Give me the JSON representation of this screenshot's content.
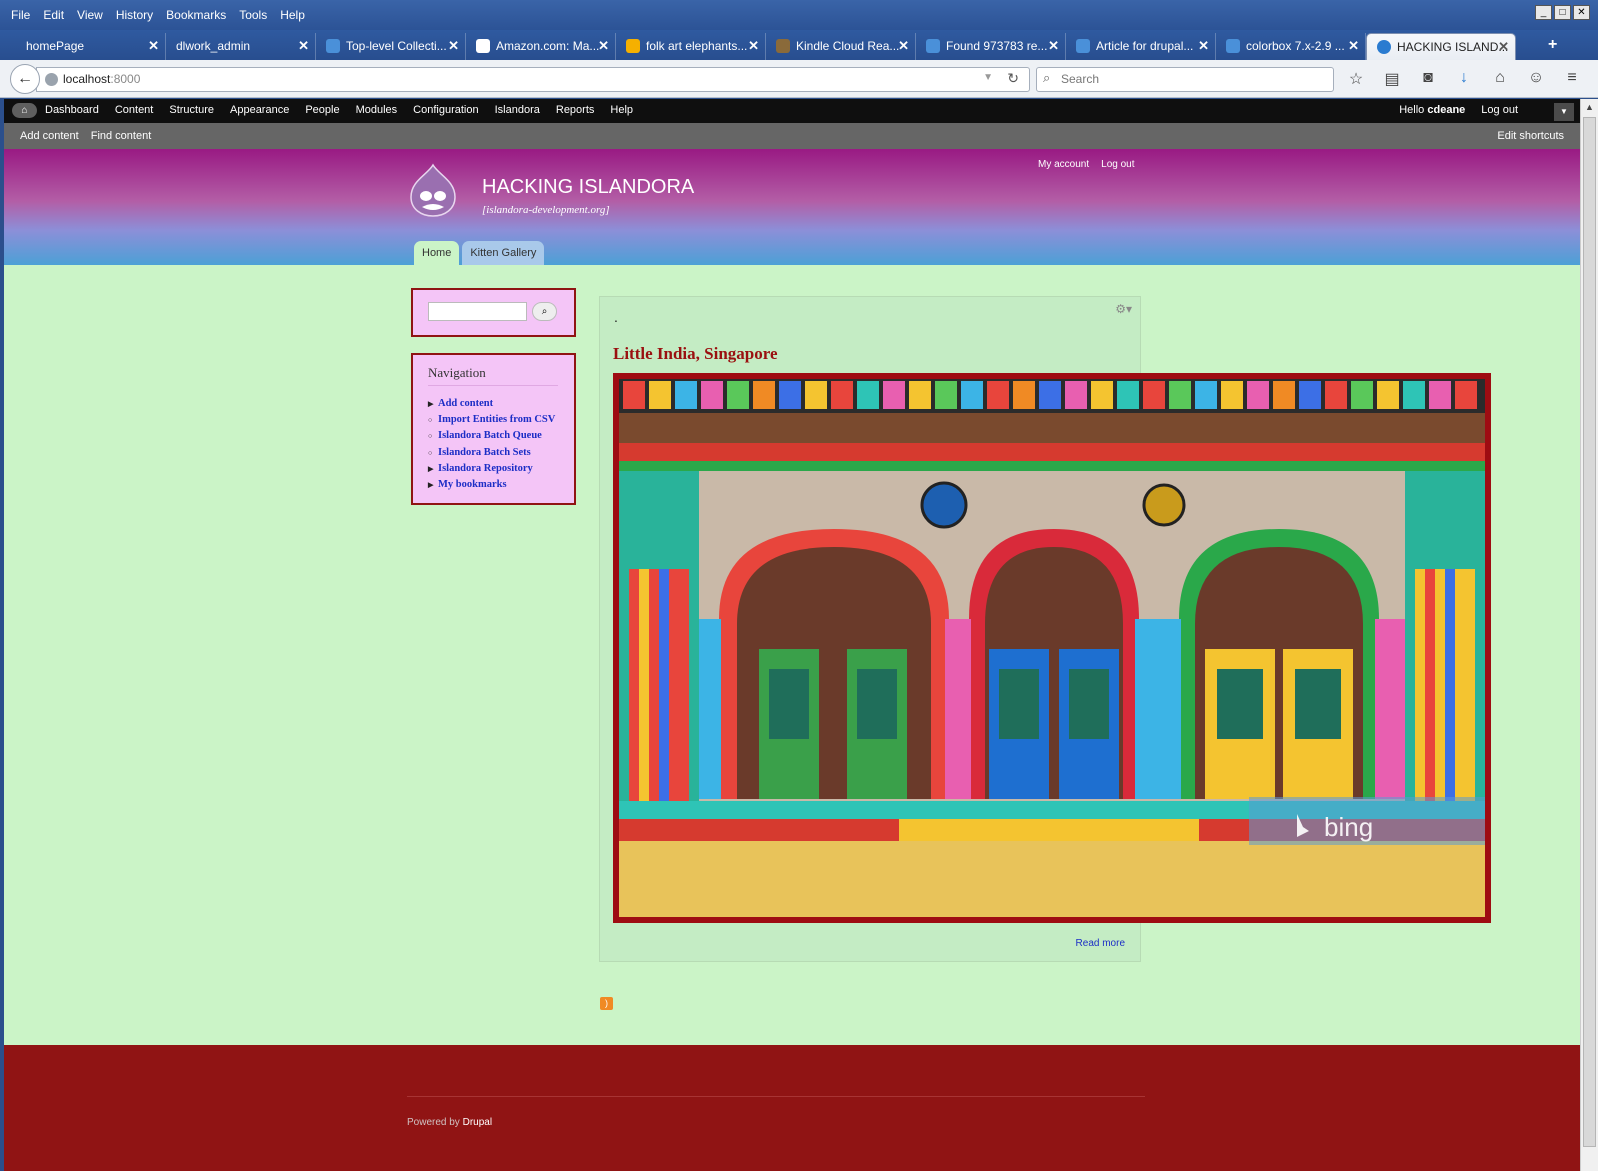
{
  "window": {
    "menu": [
      "File",
      "Edit",
      "View",
      "History",
      "Bookmarks",
      "Tools",
      "Help"
    ]
  },
  "tabs": [
    {
      "label": "homePage",
      "icon": "none-icon"
    },
    {
      "label": "dlwork_admin",
      "icon": "none-icon"
    },
    {
      "label": "Top-level Collecti...",
      "icon": "drupal-icon"
    },
    {
      "label": "Amazon.com: Ma...",
      "icon": "amazon-icon"
    },
    {
      "label": "folk art elephants...",
      "icon": "bing-icon"
    },
    {
      "label": "Kindle Cloud Rea...",
      "icon": "kindle-icon"
    },
    {
      "label": "Found 973783 re...",
      "icon": "drupal-icon"
    },
    {
      "label": "Article for drupal...",
      "icon": "drupal-icon"
    },
    {
      "label": "colorbox 7.x-2.9 ...",
      "icon": "drupal-icon"
    },
    {
      "label": "HACKING ISLAND...",
      "icon": "drupal-icon"
    }
  ],
  "browser": {
    "url_host": "localhost",
    "url_port": ":8000",
    "search_placeholder": "Search"
  },
  "admin_menu": {
    "items": [
      "Dashboard",
      "Content",
      "Structure",
      "Appearance",
      "People",
      "Modules",
      "Configuration",
      "Islandora",
      "Reports",
      "Help"
    ],
    "hello": "Hello",
    "user": "cdeane",
    "logout": "Log out"
  },
  "shortcuts": {
    "items": [
      "Add content",
      "Find content"
    ],
    "edit": "Edit shortcuts"
  },
  "site": {
    "name": "HACKING ISLANDORA",
    "slogan": "[islandora-development.org]",
    "user_menu": [
      "My account",
      "Log out"
    ],
    "tabs": [
      "Home",
      "Kitten Gallery"
    ],
    "active_tab": "Home"
  },
  "navigation": {
    "title": "Navigation",
    "items": [
      {
        "label": "Add content",
        "marker": "triangle"
      },
      {
        "label": "Import Entities from CSV",
        "marker": "circle"
      },
      {
        "label": "Islandora Batch Queue",
        "marker": "circle"
      },
      {
        "label": "Islandora Batch Sets",
        "marker": "circle"
      },
      {
        "label": "Islandora Repository",
        "marker": "triangle"
      },
      {
        "label": "My bookmarks",
        "marker": "triangle"
      }
    ]
  },
  "node": {
    "dot": ".",
    "title": "Little India, Singapore",
    "image_watermark": "bing",
    "read_more": "Read more"
  },
  "footer": {
    "powered_prefix": "Powered by",
    "powered_link": "Drupal"
  },
  "colors": {
    "page_bg": "#cbf4c7",
    "footer_bg": "#901414",
    "block_bg": "#f4c5f7",
    "title_red": "#9a1010",
    "link_blue": "#1c2ec6"
  }
}
